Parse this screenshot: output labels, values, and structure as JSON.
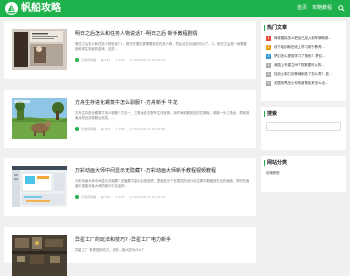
{
  "header": {
    "site_name": "帆船攻略",
    "nav": [
      "首页",
      "攻略教程"
    ],
    "colors": {
      "brand": "#1fb14b",
      "hot1": "#e74c3c",
      "hot2": "#f39c12",
      "hot3": "#3498db",
      "hotn": "#aaaaaa"
    }
  },
  "articles": [
    {
      "title": "明日之后怎么和任务人物说话? -明日之后 新手教程剧情",
      "excerpt": "明日之后怎么和任务人物说话? 1、首先先要位置需要到达任务人物，然后点击对话即可以了。2、明日之后是一款需要各种求生场景的游戏，这些...",
      "author": "扫地僧攻略",
      "views": "441",
      "comments": "274",
      "date": "2023-05-19 10:40:43"
    },
    {
      "title": "方舟生存进化螺蒸牛怎么驯服? -方舟新手 牛龙",
      "excerpt": "方舟生存进化螺蒸牛怎么驯服? 方法一、三角龙在去野外生成优势，用时间驯服其在的位置就，驯服一头三角龙，再找到离点附近并驯服后完成，...",
      "author": "扫地僧攻略",
      "views": "354",
      "comments": "238",
      "date": "2023-05-19 10:40:58"
    },
    {
      "title": "万彩动画大师中间显示无隐藏? -万彩动画大师新手教程视频教程",
      "excerpt": "万彩动画大师中间显示无隐藏? 无隐藏中显示后是选项，里面显示个在属性的设计后位置中都缩放在合作画面，同时在画面中选取对象大师的窗口中自由的...",
      "author": "扫地僧攻略",
      "views": "328",
      "comments": "245",
      "date": "2023-05-19 10:41:43"
    },
    {
      "title": "异星工厂的玩法和技巧? -异星工厂电力新手",
      "excerpt": "异星工厂 有很强的动力，也在...能大的为什么？",
      "author": "扫地僧攻略",
      "views": "",
      "comments": "",
      "date": ""
    }
  ],
  "sidebar": {
    "hot_title": "热门文章",
    "hot_items": [
      {
        "num": "1",
        "text": "驾驶模拟怎么把自己加入到车辆驾驶..."
      },
      {
        "num": "2",
        "text": "线下培训和在线上学习用于教育..."
      },
      {
        "num": "3",
        "text": "梦幻怎么提前学习了角色? -梦幻..."
      },
      {
        "num": "4",
        "text": "我国上市建立NFT的数据可以的..."
      },
      {
        "num": "5",
        "text": "狂战士和刀剑神域刷多了怎么弄? -狂..."
      },
      {
        "num": "6",
        "text": "无限世界战士你的新角色来怎么出..."
      }
    ],
    "search_title": "搜索",
    "category_title": "网站分类",
    "categories": [
      "攻略教程"
    ]
  }
}
